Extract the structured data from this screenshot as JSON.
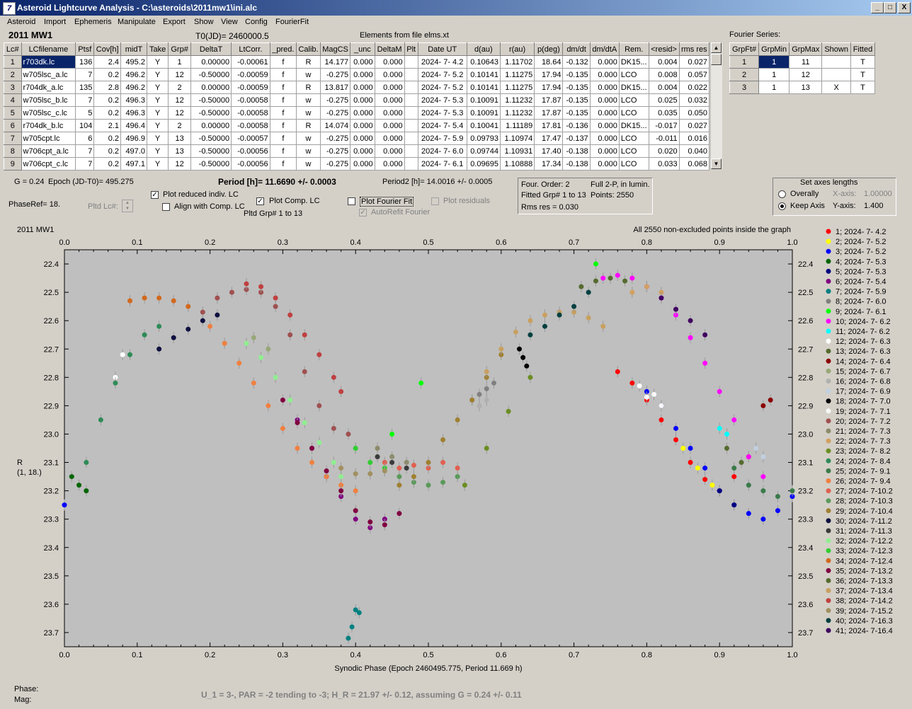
{
  "window": {
    "title": "Asteroid Lightcurve Analysis - C:\\asteroids\\2011mw1\\ini.alc",
    "icon": "app-icon",
    "min": "_",
    "max": "□",
    "close": "X"
  },
  "menu": [
    "Asteroid",
    "Import",
    "Ephemeris",
    "Manipulate",
    "Export",
    "Show",
    "View",
    "Config",
    "FourierFit"
  ],
  "header": {
    "object": "2011 MW1",
    "t0": "T0(JD)= 2460000.5",
    "elements": "Elements from file elms.xt",
    "fourier_title": "Fourier Series:"
  },
  "lc_table": {
    "columns": [
      "Lc#",
      "LCfilename",
      "Ptsf",
      "Cov[h]",
      "midT",
      "Take",
      "Grp#",
      "DeltaT",
      "LtCorr.",
      "_pred.",
      "Calib.",
      "MagCS",
      "_unc",
      "DeltaM",
      "Plt",
      "Date UT",
      "d(au)",
      "r(au)",
      "p(deg)",
      "dm/dt",
      "dm/dtA",
      "Rem.",
      "<resid>",
      "rms res"
    ],
    "rows": [
      [
        "1",
        "r703dk.lc",
        "136",
        "2.4",
        "495.2",
        "Y",
        "1",
        "0.00000",
        "-0.00061",
        "f",
        "R",
        "14.177",
        "0.000",
        "0.000",
        "",
        "2024- 7- 4.2",
        "0.10643",
        "1.11702",
        "18.64",
        "-0.132",
        "0.000",
        "DK15...",
        "0.004",
        "0.027"
      ],
      [
        "2",
        "w705lsc_a.lc",
        "7",
        "0.2",
        "496.2",
        "Y",
        "12",
        "-0.50000",
        "-0.00059",
        "f",
        "w",
        "-0.275",
        "0.000",
        "0.000",
        "",
        "2024- 7- 5.2",
        "0.10141",
        "1.11275",
        "17.94",
        "-0.135",
        "0.000",
        "LCO",
        "0.008",
        "0.057"
      ],
      [
        "3",
        "r704dk_a.lc",
        "135",
        "2.8",
        "496.2",
        "Y",
        "2",
        "0.00000",
        "-0.00059",
        "f",
        "R",
        "13.817",
        "0.000",
        "0.000",
        "",
        "2024- 7- 5.2",
        "0.10141",
        "1.11275",
        "17.94",
        "-0.135",
        "0.000",
        "DK15...",
        "0.004",
        "0.022"
      ],
      [
        "4",
        "w705lsc_b.lc",
        "7",
        "0.2",
        "496.3",
        "Y",
        "12",
        "-0.50000",
        "-0.00058",
        "f",
        "w",
        "-0.275",
        "0.000",
        "0.000",
        "",
        "2024- 7- 5.3",
        "0.10091",
        "1.11232",
        "17.87",
        "-0.135",
        "0.000",
        "LCO",
        "0.025",
        "0.032"
      ],
      [
        "5",
        "w705lsc_c.lc",
        "5",
        "0.2",
        "496.3",
        "Y",
        "12",
        "-0.50000",
        "-0.00058",
        "f",
        "w",
        "-0.275",
        "0.000",
        "0.000",
        "",
        "2024- 7- 5.3",
        "0.10091",
        "1.11232",
        "17.87",
        "-0.135",
        "0.000",
        "LCO",
        "0.035",
        "0.050"
      ],
      [
        "6",
        "r704dk_b.lc",
        "104",
        "2.1",
        "496.4",
        "Y",
        "2",
        "0.00000",
        "-0.00058",
        "f",
        "R",
        "14.074",
        "0.000",
        "0.000",
        "",
        "2024- 7- 5.4",
        "0.10041",
        "1.11189",
        "17.81",
        "-0.136",
        "0.000",
        "DK15...",
        "-0.017",
        "0.027"
      ],
      [
        "7",
        "w705cpt.lc",
        "6",
        "0.2",
        "496.9",
        "Y",
        "13",
        "-0.50000",
        "-0.00057",
        "f",
        "w",
        "-0.275",
        "0.000",
        "0.000",
        "",
        "2024- 7- 5.9",
        "0.09793",
        "1.10974",
        "17.47",
        "-0.137",
        "0.000",
        "LCO",
        "-0.011",
        "0.016"
      ],
      [
        "8",
        "w706cpt_a.lc",
        "7",
        "0.2",
        "497.0",
        "Y",
        "13",
        "-0.50000",
        "-0.00056",
        "f",
        "w",
        "-0.275",
        "0.000",
        "0.000",
        "",
        "2024- 7- 6.0",
        "0.09744",
        "1.10931",
        "17.40",
        "-0.138",
        "0.000",
        "LCO",
        "0.020",
        "0.040"
      ],
      [
        "9",
        "w706cpt_c.lc",
        "7",
        "0.2",
        "497.1",
        "Y",
        "12",
        "-0.50000",
        "-0.00056",
        "f",
        "w",
        "-0.275",
        "0.000",
        "0.000",
        "",
        "2024- 7- 6.1",
        "0.09695",
        "1.10888",
        "17.34",
        "-0.138",
        "0.000",
        "LCO",
        "0.033",
        "0.068"
      ]
    ]
  },
  "fourier_table": {
    "columns": [
      "GrpFt#",
      "GrpMin",
      "GrpMax",
      "Shown",
      "Fitted"
    ],
    "rows": [
      [
        "1",
        "1",
        "11",
        "",
        "T"
      ],
      [
        "2",
        "1",
        "12",
        "",
        "T"
      ],
      [
        "3",
        "1",
        "13",
        "X",
        "T"
      ]
    ]
  },
  "controls": {
    "g": "G = 0.24",
    "epoch": "Epoch (JD-T0)= 495.275",
    "phaseref": "PhaseRef= 18.",
    "period": "Period [h]= 11.6690 +/- 0.0003",
    "period2": "Period2 [h]= 14.0016 +/- 0.0005",
    "pltd_lc": "Pltd Lc#:",
    "pltd_grp": "Pltd Grp#  1   to   13",
    "plot_reduced": "Plot reduced indiv. LC",
    "align": "Align with Comp. LC",
    "plot_comp": "Plot Comp. LC",
    "plot_fourier": "Plot Fourier Fit",
    "autorefit": "AutoRefit Fourier",
    "plot_resid": "Plot residuals",
    "four_order": "Four. Order:  2",
    "full2p": "Full 2-P, in lumin.",
    "fitted": "Fitted Grp# 1 to 13",
    "points": "Points: 2550",
    "rms": "Rms res     = 0.030",
    "axes_title": "Set axes lengths",
    "overally": "Overally",
    "keepaxis": "Keep Axis",
    "xaxis_lbl": "X-axis:",
    "xaxis_val": "1.00000",
    "yaxis_lbl": "Y-axis:",
    "yaxis_val": "1.400"
  },
  "chart_data": {
    "type": "scatter",
    "title": "2011 MW1",
    "note": "All 2550 non-excluded points inside the graph",
    "xlabel": "Synodic Phase (Epoch 2460495.775, Period 11.669 h)",
    "ylabel": "R",
    "ylabel2": "(1, 18.)",
    "xlim": [
      0,
      1
    ],
    "ylim": [
      23.75,
      22.35
    ],
    "xticks": [
      "0.0",
      "0.1",
      "0.2",
      "0.3",
      "0.4",
      "0.5",
      "0.6",
      "0.7",
      "0.8",
      "0.9",
      "1.0"
    ],
    "yticks": [
      "22.4",
      "22.5",
      "22.6",
      "22.7",
      "22.8",
      "22.9",
      "23.0",
      "23.1",
      "23.2",
      "23.3",
      "23.4",
      "23.5",
      "23.6",
      "23.7"
    ],
    "series": [
      {
        "name": "1; 2024- 7- 4.2",
        "color": "#ff0000",
        "x": [
          0.76,
          0.78,
          0.8,
          0.82,
          0.84,
          0.86,
          0.88,
          0.9,
          0.92,
          0.94
        ],
        "y": [
          22.78,
          22.82,
          22.88,
          22.95,
          23.02,
          23.1,
          23.16,
          23.2,
          23.15,
          23.08
        ]
      },
      {
        "name": "2; 2024- 7- 5.2",
        "color": "#ffff00",
        "x": [
          0.85,
          0.87,
          0.89
        ],
        "y": [
          23.05,
          23.12,
          23.18
        ]
      },
      {
        "name": "3; 2024- 7- 5.2",
        "color": "#0000ff",
        "x": [
          0.0,
          0.8,
          0.82,
          0.84,
          0.86,
          0.88,
          0.9,
          0.92,
          0.94,
          0.96,
          0.98,
          1.0
        ],
        "y": [
          23.25,
          22.85,
          22.9,
          22.98,
          23.05,
          23.12,
          23.2,
          23.25,
          23.28,
          23.3,
          23.27,
          23.22
        ]
      },
      {
        "name": "4; 2024- 7- 5.3",
        "color": "#006400",
        "x": [
          0.01,
          0.02,
          0.03
        ],
        "y": [
          23.15,
          23.18,
          23.2
        ]
      },
      {
        "name": "5; 2024- 7- 5.3",
        "color": "#000080",
        "x": [
          0.9,
          0.92
        ],
        "y": [
          23.2,
          23.25
        ]
      },
      {
        "name": "6; 2024- 7- 5.4",
        "color": "#800080",
        "x": [
          0.32,
          0.34,
          0.36,
          0.38,
          0.4,
          0.42,
          0.44
        ],
        "y": [
          22.95,
          23.05,
          23.15,
          23.22,
          23.3,
          23.33,
          23.3
        ]
      },
      {
        "name": "7; 2024- 7- 5.9",
        "color": "#008080",
        "x": [
          0.39,
          0.395,
          0.4,
          0.405
        ],
        "y": [
          23.72,
          23.68,
          23.62,
          23.63
        ]
      },
      {
        "name": "8; 2024- 7- 6.0",
        "color": "#808080",
        "x": [
          0.56,
          0.57,
          0.58,
          0.59
        ],
        "y": [
          22.88,
          22.86,
          22.84,
          22.82
        ]
      },
      {
        "name": "9; 2024- 7- 6.1",
        "color": "#00ff00",
        "x": [
          0.4,
          0.45,
          0.49,
          0.73
        ],
        "y": [
          23.05,
          23.0,
          22.82,
          22.4
        ]
      },
      {
        "name": "10; 2024- 7- 6.2",
        "color": "#ff00ff",
        "x": [
          0.74,
          0.76,
          0.78,
          0.8,
          0.82,
          0.84,
          0.86,
          0.88,
          0.9,
          0.92,
          0.94,
          0.96
        ],
        "y": [
          22.45,
          22.44,
          22.45,
          22.48,
          22.52,
          22.58,
          22.66,
          22.75,
          22.85,
          22.95,
          23.08,
          23.15
        ]
      },
      {
        "name": "11; 2024- 7- 6.2",
        "color": "#00ffff",
        "x": [
          0.9,
          0.91
        ],
        "y": [
          22.98,
          23.0
        ]
      },
      {
        "name": "12; 2024- 7- 6.3",
        "color": "#ffffff",
        "x": [
          0.07,
          0.08,
          0.79,
          0.8
        ],
        "y": [
          22.8,
          22.72,
          22.83,
          22.87
        ]
      },
      {
        "name": "13; 2024- 7- 6.3",
        "color": "#556b2f",
        "x": [
          0.91,
          0.93
        ],
        "y": [
          23.05,
          23.1
        ]
      },
      {
        "name": "14; 2024- 7- 6.4",
        "color": "#8b0000",
        "x": [
          0.96,
          0.97
        ],
        "y": [
          22.9,
          22.88
        ]
      },
      {
        "name": "15; 2024- 7- 6.7",
        "color": "#98a878",
        "x": [
          0.26,
          0.28
        ],
        "y": [
          22.66,
          22.7
        ]
      },
      {
        "name": "16; 2024- 7- 6.8",
        "color": "#b0b0b0",
        "x": [
          0.57,
          0.58
        ],
        "y": [
          22.9,
          22.88
        ]
      },
      {
        "name": "17; 2024- 7- 6.9",
        "color": "#c0d0e0",
        "x": [
          0.95,
          0.96
        ],
        "y": [
          23.05,
          23.08
        ]
      },
      {
        "name": "18; 2024- 7- 7.0",
        "color": "#000000",
        "x": [
          0.625,
          0.63,
          0.635
        ],
        "y": [
          22.7,
          22.73,
          22.76
        ]
      },
      {
        "name": "19; 2024- 7- 7.1",
        "color": "#f8f8f8",
        "x": [
          0.81,
          0.82
        ],
        "y": [
          22.86,
          22.9
        ]
      },
      {
        "name": "20; 2024- 7- 7.2",
        "color": "#a05050",
        "x": [
          0.19,
          0.21,
          0.23,
          0.25,
          0.27,
          0.29,
          0.31,
          0.33,
          0.35,
          0.37,
          0.39
        ],
        "y": [
          22.57,
          22.52,
          22.5,
          22.49,
          22.5,
          22.55,
          22.65,
          22.78,
          22.9,
          22.98,
          23.0
        ]
      },
      {
        "name": "21; 2024- 7- 7.3",
        "color": "#8b8b6b",
        "x": [
          0.43,
          0.45,
          0.47
        ],
        "y": [
          23.05,
          23.08,
          23.1
        ]
      },
      {
        "name": "22; 2024- 7- 7.3",
        "color": "#d2a060",
        "x": [
          0.78,
          0.8,
          0.82
        ],
        "y": [
          22.5,
          22.48,
          22.5
        ]
      },
      {
        "name": "23; 2024- 7- 8.2",
        "color": "#6b8e23",
        "x": [
          0.55,
          0.58,
          0.61,
          0.64
        ],
        "y": [
          23.18,
          23.05,
          22.92,
          22.8
        ]
      },
      {
        "name": "24; 2024- 7- 8.4",
        "color": "#2e8b57",
        "x": [
          0.03,
          0.05,
          0.07,
          0.09,
          0.11,
          0.13
        ],
        "y": [
          23.1,
          22.95,
          22.82,
          22.72,
          22.65,
          22.62
        ]
      },
      {
        "name": "25; 2024- 7- 9.1",
        "color": "#3a7a4a",
        "x": [
          0.92,
          0.94,
          0.96,
          0.98,
          1.0
        ],
        "y": [
          23.12,
          23.18,
          23.2,
          23.22,
          23.2
        ]
      },
      {
        "name": "26; 2024- 7- 9.4",
        "color": "#f08040",
        "x": [
          0.2,
          0.22,
          0.24,
          0.26,
          0.28,
          0.3,
          0.32,
          0.34,
          0.36,
          0.38,
          0.4
        ],
        "y": [
          22.62,
          22.68,
          22.75,
          22.82,
          22.9,
          22.98,
          23.05,
          23.1,
          23.15,
          23.18,
          23.2
        ]
      },
      {
        "name": "27; 2024- 7-10.2",
        "color": "#e06050",
        "x": [
          0.44,
          0.46,
          0.48,
          0.5,
          0.52,
          0.54
        ],
        "y": [
          23.1,
          23.12,
          23.11,
          23.12,
          23.1,
          23.12
        ]
      },
      {
        "name": "28; 2024- 7-10.3",
        "color": "#5a9a5a",
        "x": [
          0.46,
          0.48,
          0.5,
          0.52,
          0.54
        ],
        "y": [
          23.15,
          23.17,
          23.18,
          23.17,
          23.15
        ]
      },
      {
        "name": "29; 2024- 7-10.4",
        "color": "#a08030",
        "x": [
          0.46,
          0.48,
          0.5,
          0.52,
          0.54,
          0.56,
          0.58,
          0.6
        ],
        "y": [
          23.18,
          23.15,
          23.1,
          23.02,
          22.95,
          22.88,
          22.8,
          22.72
        ]
      },
      {
        "name": "30; 2024- 7-11.2",
        "color": "#101040",
        "x": [
          0.13,
          0.15,
          0.17,
          0.19,
          0.21
        ],
        "y": [
          22.7,
          22.66,
          22.63,
          22.6,
          22.58
        ]
      },
      {
        "name": "31; 2024- 7-11.3",
        "color": "#3a3a3a",
        "x": [
          0.43,
          0.45,
          0.47
        ],
        "y": [
          23.08,
          23.1,
          23.12
        ]
      },
      {
        "name": "32; 2024- 7-12.2",
        "color": "#90ee90",
        "x": [
          0.25,
          0.27,
          0.29,
          0.31,
          0.33,
          0.35,
          0.37,
          0.38
        ],
        "y": [
          22.68,
          22.73,
          22.8,
          22.88,
          22.96,
          23.03,
          23.1,
          23.15
        ]
      },
      {
        "name": "33; 2024- 7-12.3",
        "color": "#32cd32",
        "x": [
          0.4,
          0.42,
          0.44
        ],
        "y": [
          23.05,
          23.1,
          23.12
        ]
      },
      {
        "name": "34; 2024- 7-12.4",
        "color": "#d2691e",
        "x": [
          0.09,
          0.11,
          0.13,
          0.15,
          0.17
        ],
        "y": [
          22.53,
          22.52,
          22.52,
          22.53,
          22.55
        ]
      },
      {
        "name": "35; 2024- 7-13.2",
        "color": "#800040",
        "x": [
          0.3,
          0.32,
          0.34,
          0.36,
          0.38,
          0.4,
          0.42,
          0.44,
          0.46
        ],
        "y": [
          22.88,
          22.96,
          23.05,
          23.13,
          23.2,
          23.27,
          23.31,
          23.32,
          23.28
        ]
      },
      {
        "name": "36; 2024- 7-13.3",
        "color": "#556b2f",
        "x": [
          0.71,
          0.73,
          0.75,
          0.77
        ],
        "y": [
          22.48,
          22.46,
          22.45,
          22.46
        ]
      },
      {
        "name": "37; 2024- 7-13.4",
        "color": "#c8a060",
        "x": [
          0.58,
          0.6,
          0.62,
          0.64,
          0.66,
          0.68,
          0.7,
          0.72,
          0.74
        ],
        "y": [
          22.78,
          22.7,
          22.64,
          22.6,
          22.58,
          22.57,
          22.57,
          22.59,
          22.62
        ]
      },
      {
        "name": "38; 2024- 7-14.2",
        "color": "#c04040",
        "x": [
          0.25,
          0.27,
          0.29,
          0.31,
          0.33,
          0.35,
          0.37,
          0.38
        ],
        "y": [
          22.47,
          22.48,
          22.52,
          22.58,
          22.65,
          22.72,
          22.8,
          22.85
        ]
      },
      {
        "name": "39; 2024- 7-15.2",
        "color": "#a09060",
        "x": [
          0.38,
          0.4,
          0.42,
          0.44
        ],
        "y": [
          23.12,
          23.14,
          23.14,
          23.13
        ]
      },
      {
        "name": "40; 2024- 7-16.3",
        "color": "#004040",
        "x": [
          0.64,
          0.66,
          0.68,
          0.7,
          0.72
        ],
        "y": [
          22.65,
          22.62,
          22.58,
          22.55,
          22.5
        ]
      },
      {
        "name": "41; 2024- 7-16.4",
        "color": "#400060",
        "x": [
          0.82,
          0.84,
          0.86,
          0.88
        ],
        "y": [
          22.52,
          22.56,
          22.6,
          22.65
        ]
      }
    ]
  },
  "footer": {
    "phase": "Phase:",
    "mag": "Mag:",
    "result": "U_1 = 3-, PAR = -2 tending to -3; H_R = 21.97 +/- 0.12, assuming G = 0.24 +/- 0.11"
  }
}
